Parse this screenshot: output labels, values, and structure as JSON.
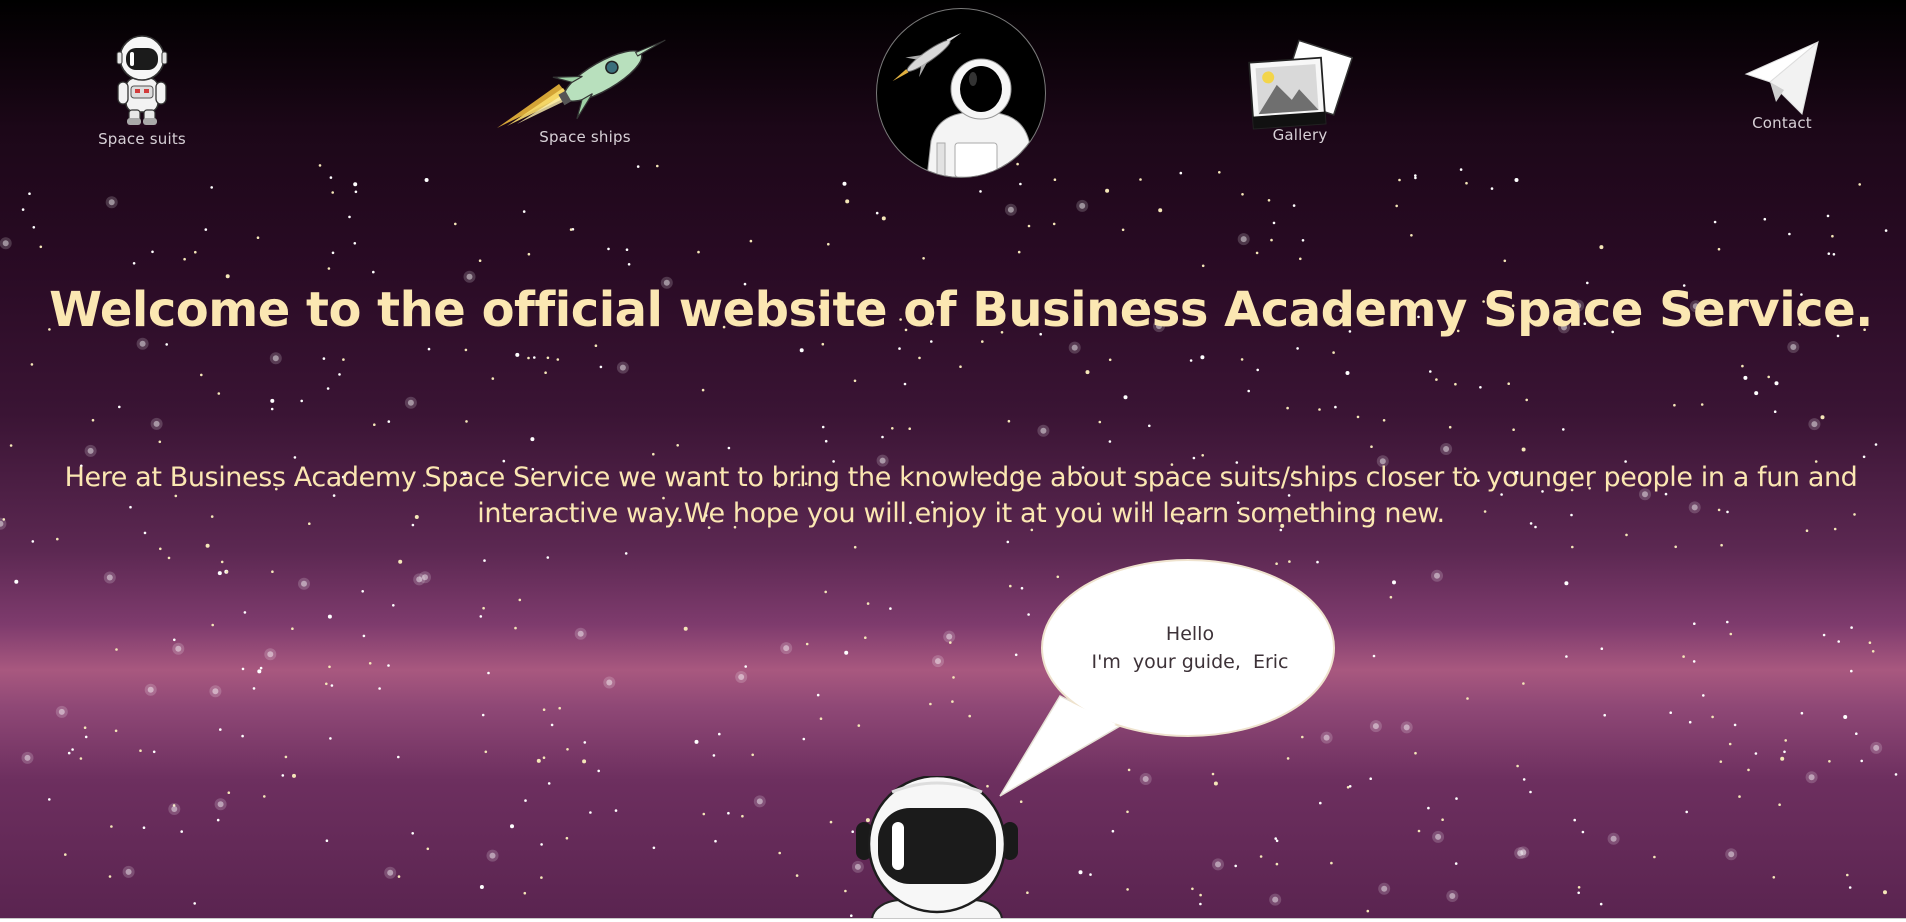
{
  "nav": {
    "items": [
      {
        "label": "Space suits",
        "icon": "astronaut-icon"
      },
      {
        "label": "Space ships",
        "icon": "rocket-icon"
      },
      {
        "label": "Gallery",
        "icon": "photos-icon"
      },
      {
        "label": "Contact",
        "icon": "paper-plane-icon"
      }
    ],
    "logo_icon": "astronaut-logo-icon"
  },
  "hero": {
    "headline": "Welcome to the official website of Business Academy Space Service.",
    "intro": "Here at Business Academy Space Service we want to bring the knowledge about space suits/ships closer to younger people in a fun and interactive way.We hope you will enjoy it at you will learn something new."
  },
  "guide": {
    "line1": "Hello",
    "line2": "I'm  your guide,  Eric",
    "icon": "astronaut-guide-icon"
  },
  "colors": {
    "headline": "#fbe7b2",
    "nav_label": "#d7d0d6",
    "bubble_text": "#3d3238"
  }
}
